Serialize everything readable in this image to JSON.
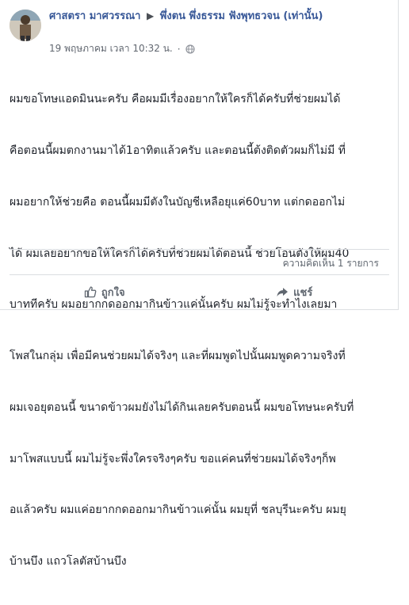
{
  "post": {
    "author": "ศาสตรา มาศวรรณา",
    "group": "พึ่งตน พึ่งธรรม ฟังพุทธวจน (เท่านั้น)",
    "timestamp": "19 พฤษภาคม เวลา 10:32 น.",
    "body_lines": [
      "ผมขอโทษแอดมินนะครับ คือผมมีเรื่องอยากให้ใครก็ได้ครับที่ช่วยผมได้",
      "คือตอนนี้ผมตกงานมาได้1อาทิตแล้วครับ และตอนนี้ต้งติดตัวผมก็ไม่มี ที่",
      "ผมอยากให้ช่วยคือ ตอนนี้ผมมีตังในบัญชีเหลือยุแค่60บาท แต่กดออกไม่",
      "ได้ ผมเลยอยากขอให้ใครก็ได้ครับที่ช่วยผมได้ตอนนี้ ช่วยโอนตังให้ผม40",
      "บาททีครับ ผมอยากกดออกมากินข้าวแค่นั้นครับ ผมไม่รู้จะทำไงเลยมา",
      "โพสในกลุ่ม เพื่อมีคนช่วยผมได้จริงๆ และที่ผมพูดไปนั้นผมพูดความจริงที่",
      "ผมเจอยุตอนนี้ ขนาดข้าวผมยังไม่ได้กินเลยครับตอนนี้ ผมขอโทษนะครับที่",
      "มาโพสแบบนี้ ผมไม่รู้จะพึ่งใครจริงๆครับ ขอแค่คนที่ช่วยผมได้จริงๆก็พ",
      "อแล้วครับ ผมแค่อยากกดออกมากินข้าวแค่นั้น ผมยุที่ ชลบุรีนะครับ ผมยุ",
      "บ้านบึง แถวโลตัสบ้านบึง"
    ]
  },
  "stats": {
    "comments": "ความคิดเห็น 1 รายการ"
  },
  "actions": {
    "like": "ถูกใจ",
    "share": "แชร์"
  },
  "icons": {
    "audience": "globe-icon",
    "like": "thumbs-up-icon",
    "share": "share-arrow-icon",
    "separator": "triangle-right-icon"
  },
  "colors": {
    "link": "#385898",
    "text": "#1d2129",
    "muted": "#606770"
  }
}
